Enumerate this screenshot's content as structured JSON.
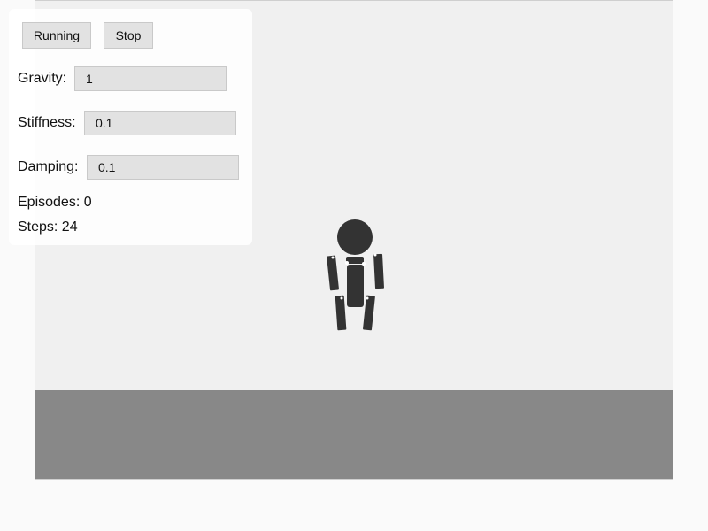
{
  "controls": {
    "run_button_label": "Running",
    "stop_button_label": "Stop",
    "gravity": {
      "label": "Gravity:",
      "value": "1"
    },
    "stiffness": {
      "label": "Stiffness:",
      "value": "0.1"
    },
    "damping": {
      "label": "Damping:",
      "value": "0.1"
    }
  },
  "stats": {
    "episodes_label": "Episodes: 0",
    "steps_label": "Steps: 24"
  },
  "colors": {
    "stage_background": "#f0f0f0",
    "ground": "#888888",
    "figure": "#333333"
  }
}
